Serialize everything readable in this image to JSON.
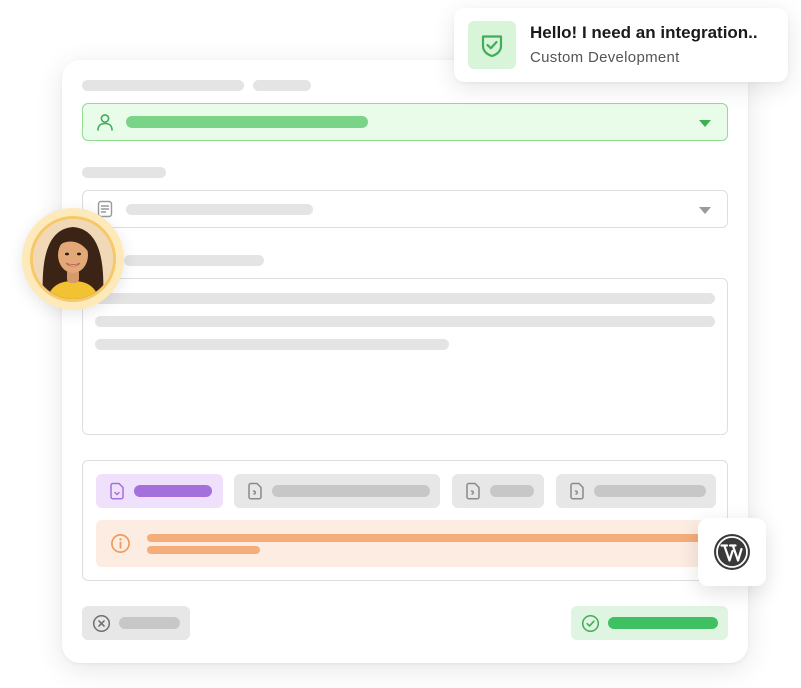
{
  "notification": {
    "title": "Hello! I need an integration..",
    "subtitle": "Custom Development",
    "icon": "shield-check-icon",
    "accent": "#3fae57"
  },
  "form": {
    "contact_field": {
      "icon": "user-icon",
      "state": "selected",
      "accent": "#8fdc92"
    },
    "type_field": {
      "icon": "document-icon",
      "state": "empty"
    },
    "attachments": [
      {
        "icon": "file-icon",
        "state": "active",
        "accent": "#a56fdc"
      },
      {
        "icon": "file-icon",
        "state": "inactive"
      },
      {
        "icon": "file-icon",
        "state": "inactive"
      },
      {
        "icon": "file-icon",
        "state": "inactive"
      }
    ],
    "warning": {
      "icon": "info-icon",
      "accent": "#f5ad7a"
    },
    "cancel_button": {
      "icon": "close-circle-icon"
    },
    "submit_button": {
      "icon": "check-circle-icon",
      "accent": "#3fc062"
    }
  },
  "avatar": {
    "icon": "user-avatar"
  },
  "integration_badge": {
    "icon": "wordpress-icon"
  }
}
